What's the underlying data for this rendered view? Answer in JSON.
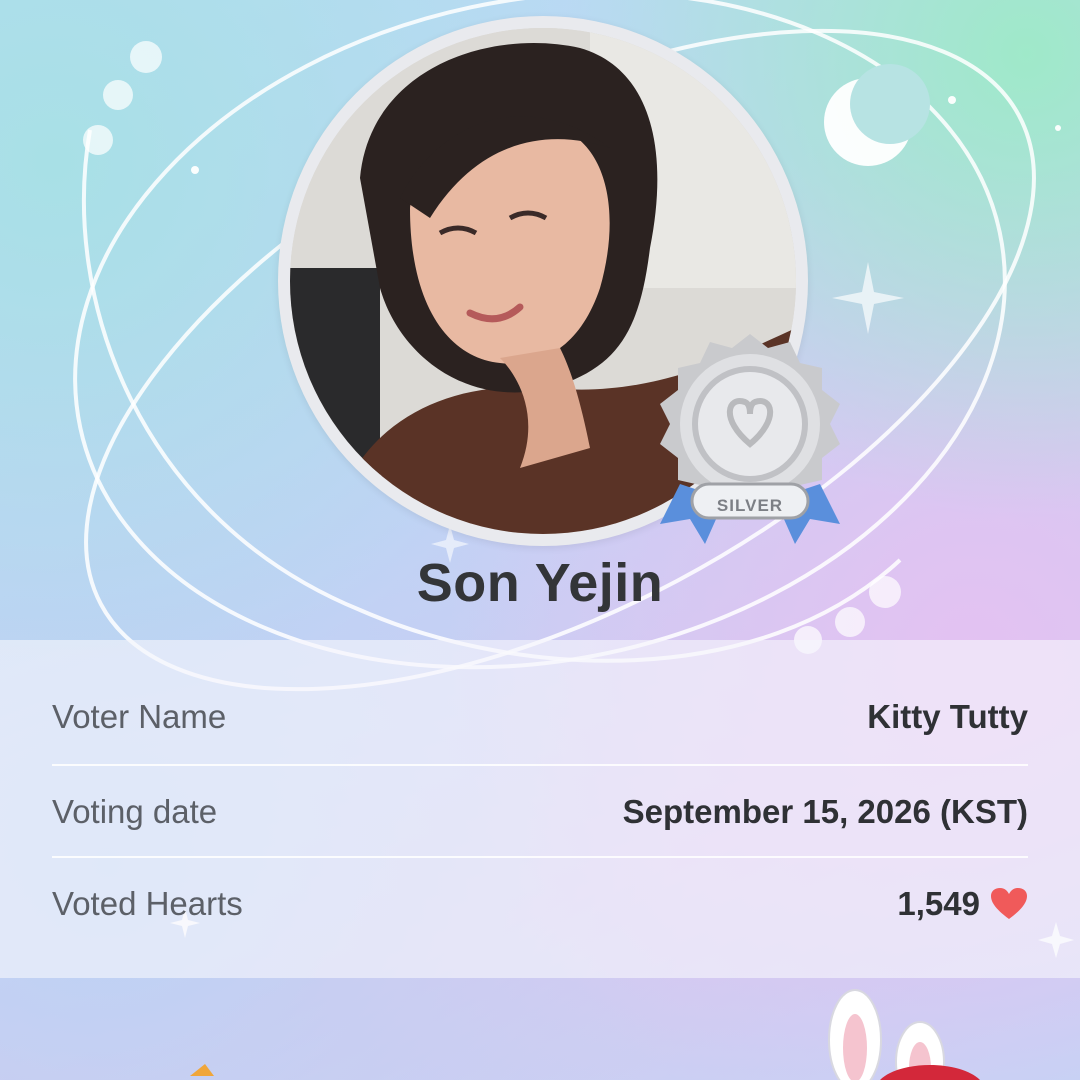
{
  "profile": {
    "name": "Son Yejin",
    "badge_label": "SILVER"
  },
  "details": {
    "rows": [
      {
        "label": "Voter Name",
        "value": "Kitty Tutty"
      },
      {
        "label": "Voting date",
        "value": "September 15, 2026 (KST)"
      },
      {
        "label": "Voted Hearts",
        "value": "1,549"
      }
    ]
  },
  "icons": {
    "heart": "heart-icon",
    "moon": "crescent-moon-icon",
    "star": "sparkle-star-icon",
    "badge": "silver-medal-icon",
    "mascot": "bunny-mascot-icon"
  },
  "colors": {
    "heart": "#f05a5a",
    "badge_ribbon": "#5a8fdc",
    "name_text": "#333538"
  }
}
